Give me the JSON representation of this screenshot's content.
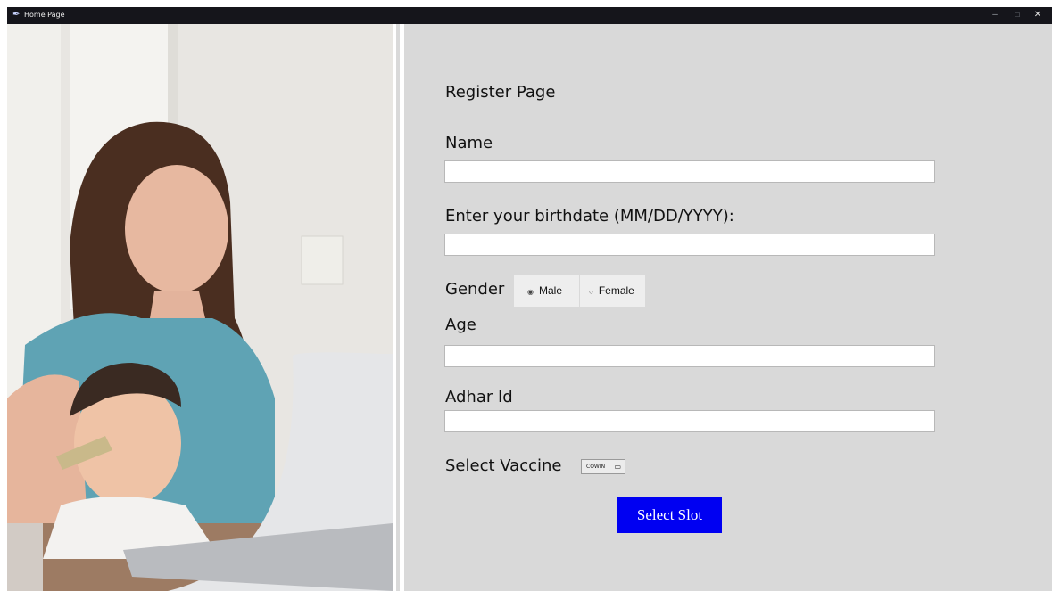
{
  "window": {
    "title": "Home Page",
    "minimize_glyph": "–",
    "maximize_glyph": "□",
    "close_glyph": "✕"
  },
  "form": {
    "heading": "Register Page",
    "name_label": "Name",
    "birthdate_label": "Enter your birthdate (MM/DD/YYYY):",
    "gender_label": "Gender",
    "gender_options": [
      "Male",
      "Female"
    ],
    "gender_selected": "Male",
    "age_label": "Age",
    "adhar_label": "Adhar Id",
    "vaccine_label": "Select Vaccine",
    "vaccine_value": "COWIN",
    "submit_label": "Select Slot"
  },
  "colors": {
    "panel_bg": "#d9d9d9",
    "button_bg": "#0000f2",
    "titlebar_bg": "#15151b"
  },
  "icons": {
    "app": "feather-icon"
  }
}
